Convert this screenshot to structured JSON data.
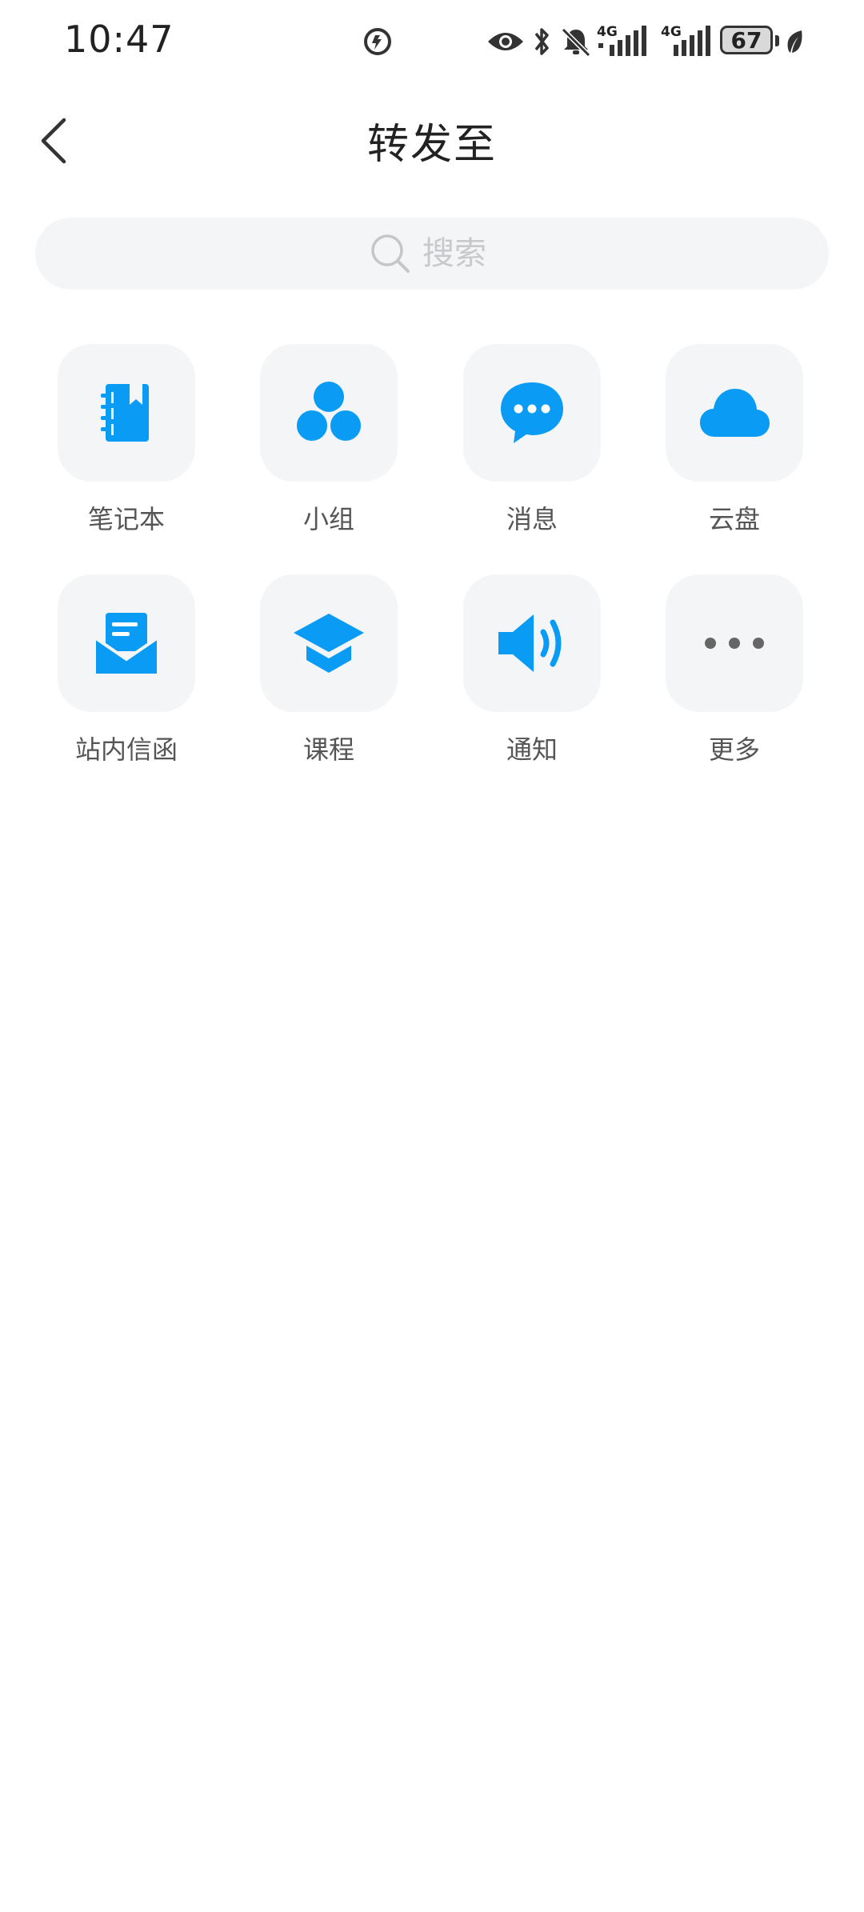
{
  "status_bar": {
    "time": "10:47",
    "network_1": "4G",
    "network_2": "4G",
    "battery": "67",
    "icons": [
      "data-saver-icon",
      "eye-icon",
      "bluetooth-icon",
      "bell-off-icon",
      "signal-icon",
      "signal-icon",
      "battery-icon",
      "leaf-icon"
    ]
  },
  "header": {
    "title": "转发至",
    "back_icon": "chevron-left-icon"
  },
  "search": {
    "placeholder": "搜索",
    "value": "",
    "icon": "search-icon"
  },
  "colors": {
    "accent": "#0a9bf5",
    "tile_bg": "#f3f5f7",
    "more_dots": "#666666"
  },
  "targets": [
    {
      "label": "笔记本",
      "icon": "notebook-icon"
    },
    {
      "label": "小组",
      "icon": "group-icon"
    },
    {
      "label": "消息",
      "icon": "chat-bubble-icon"
    },
    {
      "label": "云盘",
      "icon": "cloud-icon"
    },
    {
      "label": "站内信函",
      "icon": "mail-letter-icon"
    },
    {
      "label": "课程",
      "icon": "graduation-cap-icon"
    },
    {
      "label": "通知",
      "icon": "speaker-icon"
    },
    {
      "label": "更多",
      "icon": "more-dots-icon"
    }
  ]
}
